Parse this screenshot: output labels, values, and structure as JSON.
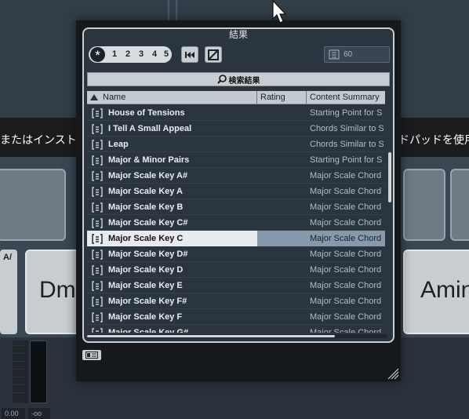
{
  "background": {
    "instruction_left": "またはインストゥル",
    "instruction_right": "ドパッドを使用",
    "pad_chords": {
      "left": "Dm",
      "right": "Amin"
    },
    "pad_small_label": "A/",
    "readout_left": "0.00",
    "readout_right": "-oo"
  },
  "window": {
    "title": "結果",
    "rating_filters": {
      "all_icon": "asterisk-icon",
      "levels": [
        "1",
        "2",
        "3",
        "4",
        "5"
      ]
    },
    "toolbar": {
      "rewind_icon": "skip-to-start-icon",
      "sync_icon": "sync-icon"
    },
    "result_count": "60",
    "search_label": "検索結果",
    "columns": {
      "name": "Name",
      "rating": "Rating",
      "summary": "Content Summary"
    },
    "rows": [
      {
        "name": "House of Tensions",
        "summary": "Starting Point for S",
        "selected": false
      },
      {
        "name": "I Tell A Small Appeal",
        "summary": "Chords Similar to S",
        "selected": false
      },
      {
        "name": "Leap",
        "summary": "Chords Similar to S",
        "selected": false
      },
      {
        "name": "Major & Minor Pairs",
        "summary": "Starting Point for S",
        "selected": false
      },
      {
        "name": "Major Scale Key A#",
        "summary": "Major Scale Chord",
        "selected": false
      },
      {
        "name": "Major Scale Key A",
        "summary": "Major Scale Chord",
        "selected": false
      },
      {
        "name": "Major Scale Key B",
        "summary": "Major Scale Chord",
        "selected": false
      },
      {
        "name": "Major Scale Key C#",
        "summary": "Major Scale Chord",
        "selected": false
      },
      {
        "name": "Major Scale Key C",
        "summary": "Major Scale Chord",
        "selected": true
      },
      {
        "name": "Major Scale Key D#",
        "summary": "Major Scale Chord",
        "selected": false
      },
      {
        "name": "Major Scale Key D",
        "summary": "Major Scale Chord",
        "selected": false
      },
      {
        "name": "Major Scale Key E",
        "summary": "Major Scale Chord",
        "selected": false
      },
      {
        "name": "Major Scale Key F#",
        "summary": "Major Scale Chord",
        "selected": false
      },
      {
        "name": "Major Scale Key F",
        "summary": "Major Scale Chord",
        "selected": false
      },
      {
        "name": "Major Scale Key G#",
        "summary": "Major Scale Chord",
        "selected": false
      }
    ],
    "footer": {
      "layout_icon": "layout-panel-icon",
      "resize_icon": "resize-grip-icon"
    }
  },
  "colors": {
    "selected_row": "#e8ebee",
    "selected_rating": "#8799ab",
    "window_bg": "#16191c",
    "list_bg": "#2b3540"
  }
}
